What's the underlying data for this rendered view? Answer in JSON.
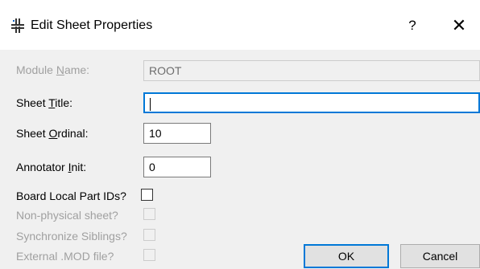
{
  "window": {
    "title": "Edit Sheet Properties",
    "help_label": "?",
    "close_label": "✕"
  },
  "fields": {
    "module_name": {
      "label_prefix": "Module ",
      "label_mnemonic": "N",
      "label_suffix": "ame:",
      "value": "ROOT"
    },
    "sheet_title": {
      "label_prefix": "Sheet ",
      "label_mnemonic": "T",
      "label_suffix": "itle:",
      "value": ""
    },
    "sheet_ordinal": {
      "label_prefix": "Sheet ",
      "label_mnemonic": "O",
      "label_suffix": "rdinal:",
      "value": "10"
    },
    "annotator_init": {
      "label_prefix": "Annotator ",
      "label_mnemonic": "I",
      "label_suffix": "nit:",
      "value": "0"
    }
  },
  "checkboxes": [
    {
      "label": "Board Local Part IDs?",
      "checked": false,
      "enabled": true
    },
    {
      "label": "Non-physical sheet?",
      "checked": false,
      "enabled": false
    },
    {
      "label": "Synchronize Siblings?",
      "checked": false,
      "enabled": false
    },
    {
      "label": "External .MOD file?",
      "checked": false,
      "enabled": false
    }
  ],
  "buttons": {
    "ok_label": "OK",
    "cancel_label": "Cancel"
  }
}
